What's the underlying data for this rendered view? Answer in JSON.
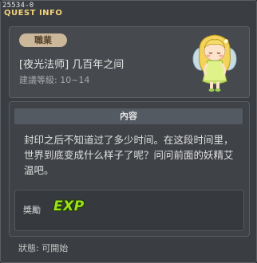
{
  "window": {
    "id_label": "25534-0",
    "title": "QUEST INFO"
  },
  "header": {
    "job_tag": "職業",
    "quest_name": "[夜光法师] 几百年之间",
    "level_range": "建議等級: 10~14",
    "npc_icon": "fairy-npc-icon"
  },
  "content": {
    "heading": "內容",
    "description": "封印之后不知道过了多少时间。在这段时间里，世界到底变成什么样子了呢？问问前面的妖精艾温吧。",
    "reward": {
      "label": "獎勵",
      "exp_text": "EXP"
    }
  },
  "status": "狀態: 可開始",
  "colors": {
    "accent": "#f3d27a",
    "exp_green": "#9be21b",
    "tag_bg": "#cbb79a"
  }
}
